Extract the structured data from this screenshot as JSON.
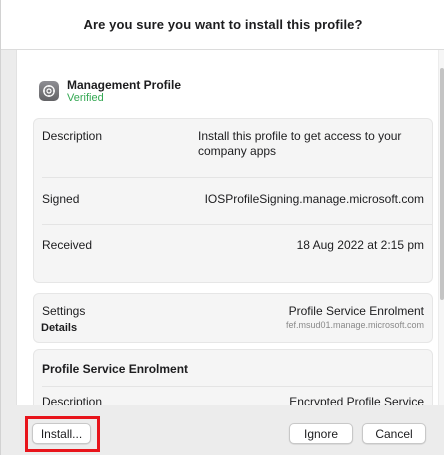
{
  "dialog": {
    "title": "Are you sure you want to install this profile?"
  },
  "profile": {
    "name": "Management Profile",
    "status": "Verified",
    "icon": "gear-icon"
  },
  "details_top": {
    "rows": [
      {
        "key": "Description",
        "value": "Install this profile to get access to your company apps"
      },
      {
        "key": "Signed",
        "value": "IOSProfileSigning.manage.microsoft.com"
      },
      {
        "key": "Received",
        "value": "18 Aug 2022 at 2:15 pm"
      }
    ]
  },
  "settings": {
    "key": "Settings",
    "value": "Profile Service Enrolment",
    "sub": "fef.msud01.manage.microsoft.com"
  },
  "details_section": {
    "label": "Details",
    "heading": "Profile Service Enrolment",
    "rows": [
      {
        "key": "Description",
        "value": "Encrypted Profile Service"
      }
    ]
  },
  "buttons": {
    "install": "Install...",
    "ignore": "Ignore",
    "cancel": "Cancel"
  },
  "colors": {
    "verified": "#34a853",
    "highlight": "#e8141b"
  }
}
